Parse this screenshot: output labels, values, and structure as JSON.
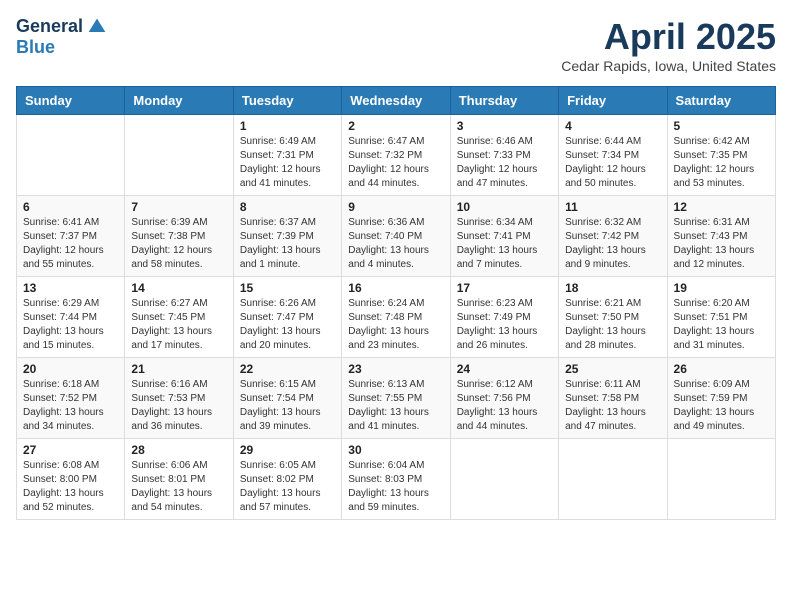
{
  "logo": {
    "general": "General",
    "blue": "Blue"
  },
  "header": {
    "month": "April 2025",
    "location": "Cedar Rapids, Iowa, United States"
  },
  "weekdays": [
    "Sunday",
    "Monday",
    "Tuesday",
    "Wednesday",
    "Thursday",
    "Friday",
    "Saturday"
  ],
  "weeks": [
    [
      {
        "day": "",
        "sunrise": "",
        "sunset": "",
        "daylight": ""
      },
      {
        "day": "",
        "sunrise": "",
        "sunset": "",
        "daylight": ""
      },
      {
        "day": "1",
        "sunrise": "Sunrise: 6:49 AM",
        "sunset": "Sunset: 7:31 PM",
        "daylight": "Daylight: 12 hours and 41 minutes."
      },
      {
        "day": "2",
        "sunrise": "Sunrise: 6:47 AM",
        "sunset": "Sunset: 7:32 PM",
        "daylight": "Daylight: 12 hours and 44 minutes."
      },
      {
        "day": "3",
        "sunrise": "Sunrise: 6:46 AM",
        "sunset": "Sunset: 7:33 PM",
        "daylight": "Daylight: 12 hours and 47 minutes."
      },
      {
        "day": "4",
        "sunrise": "Sunrise: 6:44 AM",
        "sunset": "Sunset: 7:34 PM",
        "daylight": "Daylight: 12 hours and 50 minutes."
      },
      {
        "day": "5",
        "sunrise": "Sunrise: 6:42 AM",
        "sunset": "Sunset: 7:35 PM",
        "daylight": "Daylight: 12 hours and 53 minutes."
      }
    ],
    [
      {
        "day": "6",
        "sunrise": "Sunrise: 6:41 AM",
        "sunset": "Sunset: 7:37 PM",
        "daylight": "Daylight: 12 hours and 55 minutes."
      },
      {
        "day": "7",
        "sunrise": "Sunrise: 6:39 AM",
        "sunset": "Sunset: 7:38 PM",
        "daylight": "Daylight: 12 hours and 58 minutes."
      },
      {
        "day": "8",
        "sunrise": "Sunrise: 6:37 AM",
        "sunset": "Sunset: 7:39 PM",
        "daylight": "Daylight: 13 hours and 1 minute."
      },
      {
        "day": "9",
        "sunrise": "Sunrise: 6:36 AM",
        "sunset": "Sunset: 7:40 PM",
        "daylight": "Daylight: 13 hours and 4 minutes."
      },
      {
        "day": "10",
        "sunrise": "Sunrise: 6:34 AM",
        "sunset": "Sunset: 7:41 PM",
        "daylight": "Daylight: 13 hours and 7 minutes."
      },
      {
        "day": "11",
        "sunrise": "Sunrise: 6:32 AM",
        "sunset": "Sunset: 7:42 PM",
        "daylight": "Daylight: 13 hours and 9 minutes."
      },
      {
        "day": "12",
        "sunrise": "Sunrise: 6:31 AM",
        "sunset": "Sunset: 7:43 PM",
        "daylight": "Daylight: 13 hours and 12 minutes."
      }
    ],
    [
      {
        "day": "13",
        "sunrise": "Sunrise: 6:29 AM",
        "sunset": "Sunset: 7:44 PM",
        "daylight": "Daylight: 13 hours and 15 minutes."
      },
      {
        "day": "14",
        "sunrise": "Sunrise: 6:27 AM",
        "sunset": "Sunset: 7:45 PM",
        "daylight": "Daylight: 13 hours and 17 minutes."
      },
      {
        "day": "15",
        "sunrise": "Sunrise: 6:26 AM",
        "sunset": "Sunset: 7:47 PM",
        "daylight": "Daylight: 13 hours and 20 minutes."
      },
      {
        "day": "16",
        "sunrise": "Sunrise: 6:24 AM",
        "sunset": "Sunset: 7:48 PM",
        "daylight": "Daylight: 13 hours and 23 minutes."
      },
      {
        "day": "17",
        "sunrise": "Sunrise: 6:23 AM",
        "sunset": "Sunset: 7:49 PM",
        "daylight": "Daylight: 13 hours and 26 minutes."
      },
      {
        "day": "18",
        "sunrise": "Sunrise: 6:21 AM",
        "sunset": "Sunset: 7:50 PM",
        "daylight": "Daylight: 13 hours and 28 minutes."
      },
      {
        "day": "19",
        "sunrise": "Sunrise: 6:20 AM",
        "sunset": "Sunset: 7:51 PM",
        "daylight": "Daylight: 13 hours and 31 minutes."
      }
    ],
    [
      {
        "day": "20",
        "sunrise": "Sunrise: 6:18 AM",
        "sunset": "Sunset: 7:52 PM",
        "daylight": "Daylight: 13 hours and 34 minutes."
      },
      {
        "day": "21",
        "sunrise": "Sunrise: 6:16 AM",
        "sunset": "Sunset: 7:53 PM",
        "daylight": "Daylight: 13 hours and 36 minutes."
      },
      {
        "day": "22",
        "sunrise": "Sunrise: 6:15 AM",
        "sunset": "Sunset: 7:54 PM",
        "daylight": "Daylight: 13 hours and 39 minutes."
      },
      {
        "day": "23",
        "sunrise": "Sunrise: 6:13 AM",
        "sunset": "Sunset: 7:55 PM",
        "daylight": "Daylight: 13 hours and 41 minutes."
      },
      {
        "day": "24",
        "sunrise": "Sunrise: 6:12 AM",
        "sunset": "Sunset: 7:56 PM",
        "daylight": "Daylight: 13 hours and 44 minutes."
      },
      {
        "day": "25",
        "sunrise": "Sunrise: 6:11 AM",
        "sunset": "Sunset: 7:58 PM",
        "daylight": "Daylight: 13 hours and 47 minutes."
      },
      {
        "day": "26",
        "sunrise": "Sunrise: 6:09 AM",
        "sunset": "Sunset: 7:59 PM",
        "daylight": "Daylight: 13 hours and 49 minutes."
      }
    ],
    [
      {
        "day": "27",
        "sunrise": "Sunrise: 6:08 AM",
        "sunset": "Sunset: 8:00 PM",
        "daylight": "Daylight: 13 hours and 52 minutes."
      },
      {
        "day": "28",
        "sunrise": "Sunrise: 6:06 AM",
        "sunset": "Sunset: 8:01 PM",
        "daylight": "Daylight: 13 hours and 54 minutes."
      },
      {
        "day": "29",
        "sunrise": "Sunrise: 6:05 AM",
        "sunset": "Sunset: 8:02 PM",
        "daylight": "Daylight: 13 hours and 57 minutes."
      },
      {
        "day": "30",
        "sunrise": "Sunrise: 6:04 AM",
        "sunset": "Sunset: 8:03 PM",
        "daylight": "Daylight: 13 hours and 59 minutes."
      },
      {
        "day": "",
        "sunrise": "",
        "sunset": "",
        "daylight": ""
      },
      {
        "day": "",
        "sunrise": "",
        "sunset": "",
        "daylight": ""
      },
      {
        "day": "",
        "sunrise": "",
        "sunset": "",
        "daylight": ""
      }
    ]
  ]
}
